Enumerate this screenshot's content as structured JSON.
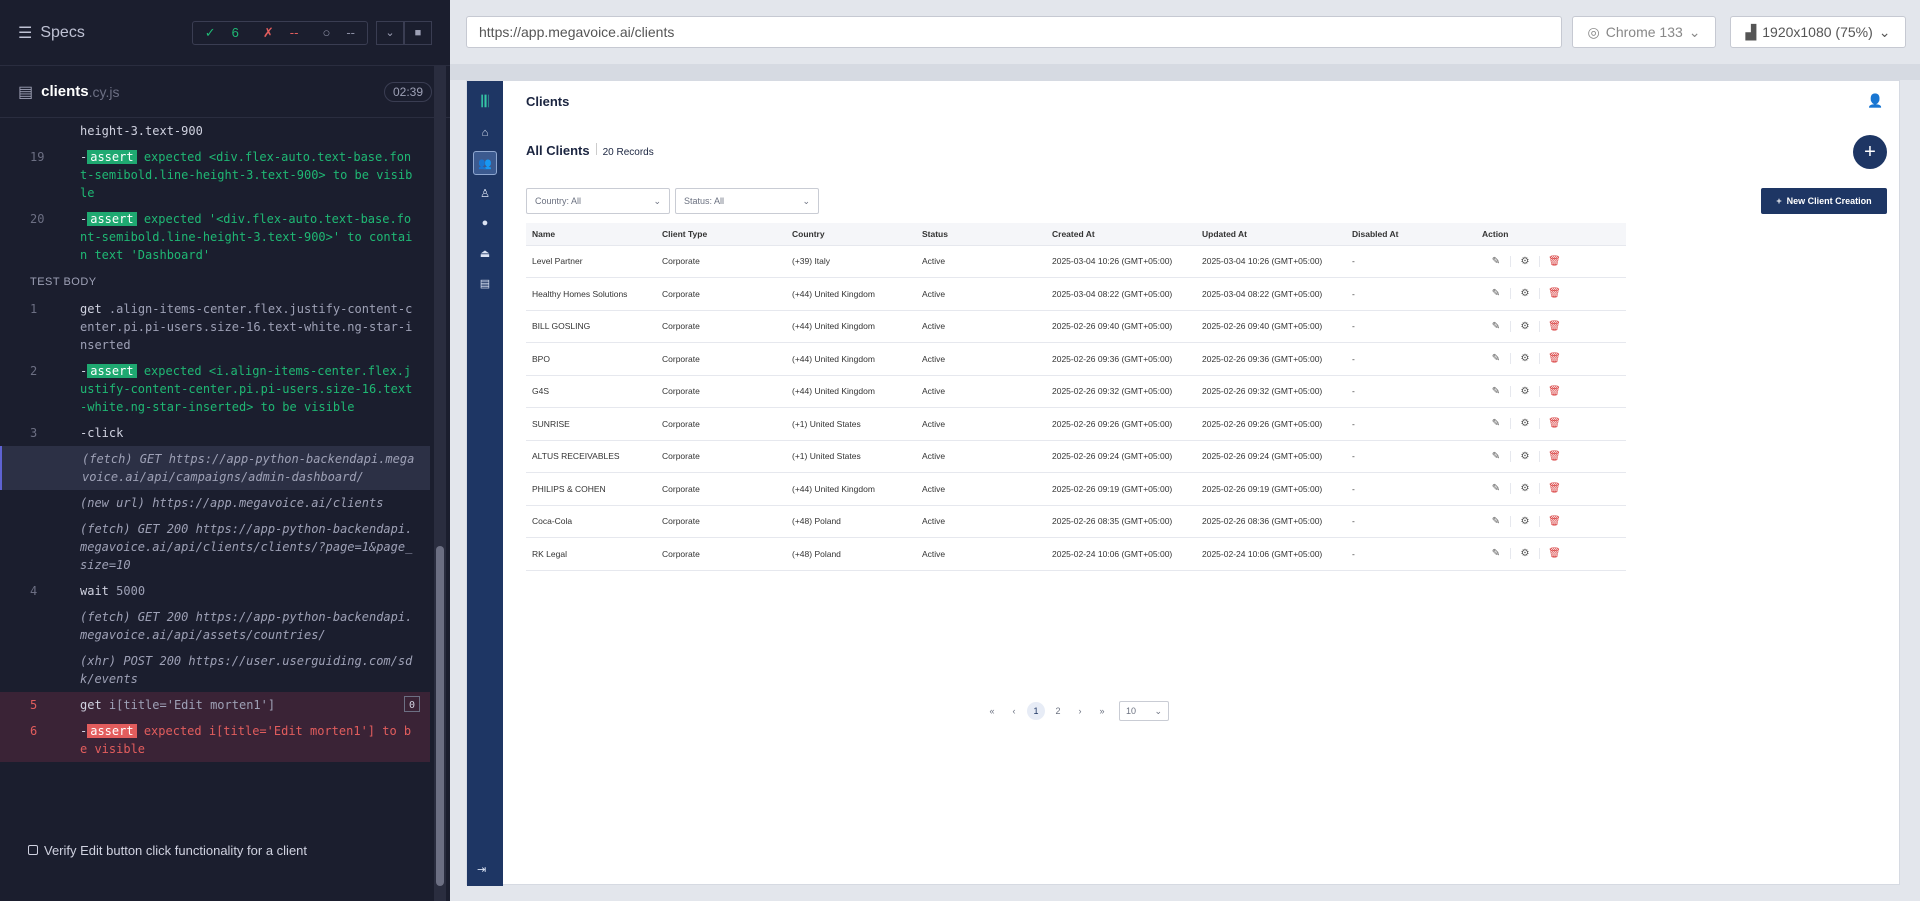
{
  "runner": {
    "specs_label": "Specs",
    "passed": "6",
    "failed": "--",
    "pending": "--",
    "file_name": "clients",
    "file_ext": ".cy.js",
    "duration": "02:39",
    "test_title": "Verify Edit button click functionality for a client",
    "section_label": "TEST BODY",
    "commands": [
      {
        "num": "",
        "text": "height-3.text-900",
        "kind": "plain"
      },
      {
        "num": "19",
        "pre": "-",
        "assert": "assert",
        "text": "expected <div.flex-auto.text-base.font-semibold.line-height-3.text-900> to be visible",
        "kind": "assert"
      },
      {
        "num": "20",
        "pre": "-",
        "assert": "assert",
        "text": "expected '<div.flex-auto.text-base.font-semibold.line-height-3.text-900>' to contain text 'Dashboard'",
        "kind": "assert"
      },
      {
        "num": "1",
        "cmd": "get",
        "text": ".align-items-center.flex.justify-content-center.pi.pi-users.size-16.text-white.ng-star-inserted",
        "kind": "get"
      },
      {
        "num": "2",
        "pre": "-",
        "assert": "assert",
        "text": "expected <i.align-items-center.flex.justify-content-center.pi.pi-users.size-16.text-white.ng-star-inserted> to be visible",
        "kind": "assert"
      },
      {
        "num": "3",
        "text": "-click",
        "kind": "plain"
      },
      {
        "num": "",
        "text": "(fetch)  GET https://app-python-backendapi.megavoice.ai/api/campaigns/admin-dashboard/",
        "kind": "log-active"
      },
      {
        "num": "",
        "text": "(new url)  https://app.megavoice.ai/clients",
        "kind": "log"
      },
      {
        "num": "",
        "text": "(fetch)  GET 200 https://app-python-backendapi.megavoice.ai/api/clients/clients/?page=1&page_size=10",
        "kind": "log"
      },
      {
        "num": "4",
        "cmd": "wait",
        "text": "5000",
        "kind": "get"
      },
      {
        "num": "",
        "text": "(fetch)  GET 200 https://app-python-backendapi.megavoice.ai/api/assets/countries/",
        "kind": "log"
      },
      {
        "num": "",
        "text": "(xhr)  POST 200 https://user.userguiding.com/sdk/events",
        "kind": "log"
      },
      {
        "num": "5",
        "cmd": "get",
        "text": "i[title='Edit morten1']",
        "badge": "0",
        "kind": "err-get"
      },
      {
        "num": "6",
        "pre": "-",
        "assert": "assert",
        "text": "expected i[title='Edit morten1'] to be visible",
        "kind": "err-assert"
      }
    ]
  },
  "browser": {
    "url": "https://app.megavoice.ai/clients",
    "browser_label": "Chrome 133",
    "viewport_label": "1920x1080 (75%)"
  },
  "app": {
    "page_title": "Clients",
    "list_title": "All Clients",
    "record_count": "20 Records",
    "country_filter": "Country: All",
    "status_filter": "Status: All",
    "new_button": "New Client Creation",
    "columns": [
      "Name",
      "Client Type",
      "Country",
      "Status",
      "Created At",
      "Updated At",
      "Disabled At",
      "Action"
    ],
    "rows": [
      {
        "name": "Level Partner",
        "type": "Corporate",
        "country": "(+39) Italy",
        "status": "Active",
        "created": "2025-03-04 10:26 (GMT+05:00)",
        "updated": "2025-03-04 10:26 (GMT+05:00)",
        "disabled": "-"
      },
      {
        "name": "Healthy Homes Solutions",
        "type": "Corporate",
        "country": "(+44) United Kingdom",
        "status": "Active",
        "created": "2025-03-04 08:22 (GMT+05:00)",
        "updated": "2025-03-04 08:22 (GMT+05:00)",
        "disabled": "-"
      },
      {
        "name": "BILL GOSLING",
        "type": "Corporate",
        "country": "(+44) United Kingdom",
        "status": "Active",
        "created": "2025-02-26 09:40 (GMT+05:00)",
        "updated": "2025-02-26 09:40 (GMT+05:00)",
        "disabled": "-"
      },
      {
        "name": "BPO",
        "type": "Corporate",
        "country": "(+44) United Kingdom",
        "status": "Active",
        "created": "2025-02-26 09:36 (GMT+05:00)",
        "updated": "2025-02-26 09:36 (GMT+05:00)",
        "disabled": "-"
      },
      {
        "name": "G4S",
        "type": "Corporate",
        "country": "(+44) United Kingdom",
        "status": "Active",
        "created": "2025-02-26 09:32 (GMT+05:00)",
        "updated": "2025-02-26 09:32 (GMT+05:00)",
        "disabled": "-"
      },
      {
        "name": "SUNRISE",
        "type": "Corporate",
        "country": "(+1) United States",
        "status": "Active",
        "created": "2025-02-26 09:26 (GMT+05:00)",
        "updated": "2025-02-26 09:26 (GMT+05:00)",
        "disabled": "-"
      },
      {
        "name": "ALTUS RECEIVABLES",
        "type": "Corporate",
        "country": "(+1) United States",
        "status": "Active",
        "created": "2025-02-26 09:24 (GMT+05:00)",
        "updated": "2025-02-26 09:24 (GMT+05:00)",
        "disabled": "-"
      },
      {
        "name": "PHILIPS & COHEN",
        "type": "Corporate",
        "country": "(+44) United Kingdom",
        "status": "Active",
        "created": "2025-02-26 09:19 (GMT+05:00)",
        "updated": "2025-02-26 09:19 (GMT+05:00)",
        "disabled": "-"
      },
      {
        "name": "Coca-Cola",
        "type": "Corporate",
        "country": "(+48) Poland",
        "status": "Active",
        "created": "2025-02-26 08:35 (GMT+05:00)",
        "updated": "2025-02-26 08:36 (GMT+05:00)",
        "disabled": "-"
      },
      {
        "name": "RK Legal",
        "type": "Corporate",
        "country": "(+48) Poland",
        "status": "Active",
        "created": "2025-02-24 10:06 (GMT+05:00)",
        "updated": "2025-02-24 10:06 (GMT+05:00)",
        "disabled": "-"
      }
    ],
    "pages": [
      "1",
      "2"
    ],
    "page_size": "10"
  }
}
